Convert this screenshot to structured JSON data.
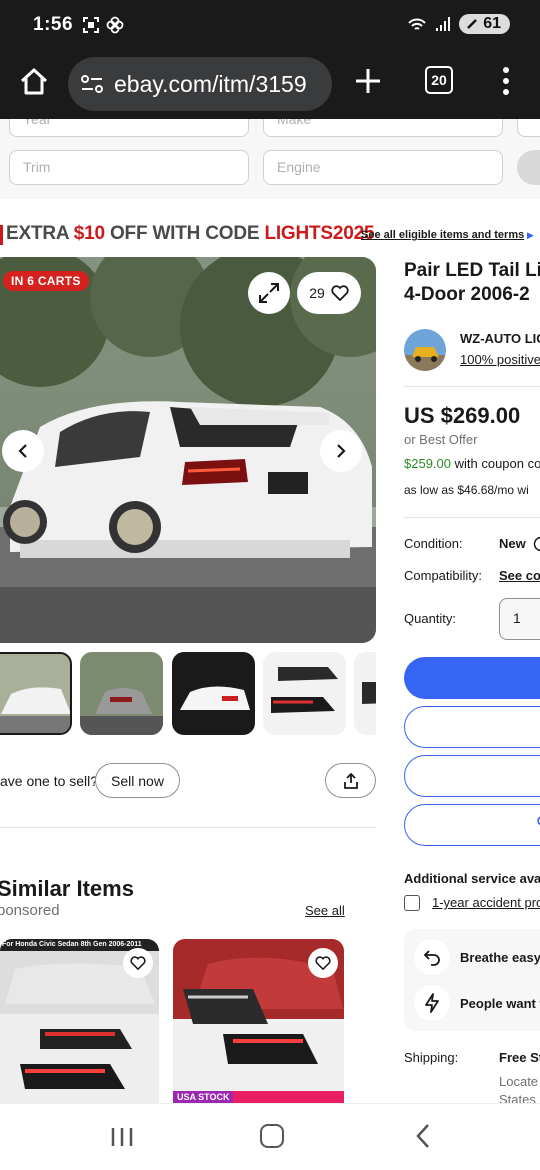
{
  "status": {
    "time": "1:56",
    "battery": "61"
  },
  "browser": {
    "url": "ebay.com/itm/3159",
    "tab_count": "20"
  },
  "filters": {
    "year": "Year",
    "make": "Make",
    "trim": "Trim",
    "engine": "Engine"
  },
  "promo": {
    "prefix": "EXTRA ",
    "amount": "$10",
    "middle": " OFF WITH CODE ",
    "code": "LIGHTS2025",
    "link": "See all eligible items and terms"
  },
  "gallery": {
    "badge": "IN 6 CARTS",
    "watch_count": "29",
    "sell_question": "ave one to sell?",
    "sell_now": "Sell now"
  },
  "similar": {
    "title": "Similar Items",
    "sponsored": "ponsored",
    "see_all": "See all",
    "card1_banner": "For Honda Civic Sedan 8th Gen 2006-2011",
    "card2_banner": "USA STOCK"
  },
  "listing": {
    "title_line1": "Pair LED Tail Li",
    "title_line2": "4-Door 2006-2",
    "seller_name": "WZ-AUTO LIG",
    "seller_feedback": "100% positive",
    "price": "US $269.00",
    "best_offer": "or Best Offer",
    "coupon_price": "$259.00",
    "coupon_text": " with coupon co",
    "financing": "as low as $46.68/mo wi",
    "condition_label": "Condition:",
    "condition_value": "New",
    "compat_label": "Compatibility:",
    "compat_value": "See co",
    "quantity_label": "Quantity:",
    "quantity_value": "1",
    "additional_service": "Additional service avai",
    "accident_plan": "1-year accident pro",
    "info1": "Breathe easy.",
    "info2": "People want t",
    "shipping_label": "Shipping:",
    "shipping_value": "Free St",
    "located1": "Locate",
    "located2": "States"
  },
  "colors": {
    "ebay_blue": "#3665f3",
    "promo_red": "#cc1a1a",
    "badge_red": "#d5221f",
    "coupon_green": "#2d8a2d"
  }
}
